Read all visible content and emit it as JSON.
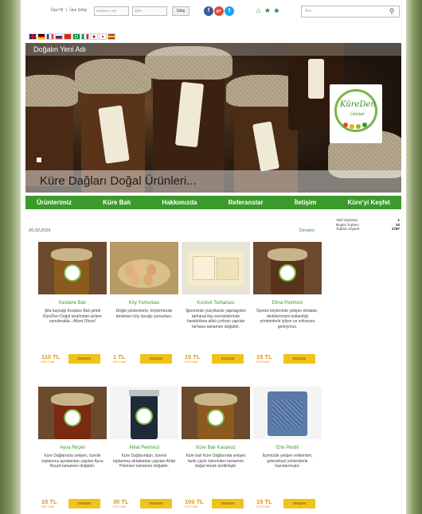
{
  "topbar": {
    "login_label": "Üye Ol",
    "separator": "|",
    "register_label": "Üye Girişi",
    "user_placeholder": "Kullanıcı Adı",
    "pass_placeholder": "Şifre",
    "login_button": "Giriş",
    "search_placeholder": "Ara...",
    "social": [
      {
        "name": "facebook",
        "glyph": "f",
        "color": "#3b5998"
      },
      {
        "name": "google-plus",
        "glyph": "g+",
        "color": "#dd4b39"
      },
      {
        "name": "twitter",
        "glyph": "t",
        "color": "#1da1f2"
      }
    ],
    "home_icons": "⌂ ★ ♣"
  },
  "flags": [
    {
      "name": "uk",
      "bg": "linear-gradient(#c8102e 0 0) center/100% 2px no-repeat, linear-gradient(#c8102e 0 0) center/2px 100% no-repeat, #012169"
    },
    {
      "name": "germany",
      "bg": "linear-gradient(#000 0 33%, #dd0000 33% 66%, #ffce00 66%)"
    },
    {
      "name": "france",
      "bg": "linear-gradient(90deg, #0055a4 0 33%, #fff 33% 66%, #ef4135 66%)"
    },
    {
      "name": "russia",
      "bg": "linear-gradient(#fff 0 33%, #0039a6 33% 66%, #d52b1e 66%)"
    },
    {
      "name": "china",
      "bg": "#de2910"
    },
    {
      "name": "brazil",
      "bg": "radial-gradient(circle, #002776 0 20%, #ffdf00 20% 45%, #009c3b 45%)"
    },
    {
      "name": "italy",
      "bg": "linear-gradient(90deg, #009246 0 33%, #fff 33% 66%, #ce2b37 66%)"
    },
    {
      "name": "japan",
      "bg": "radial-gradient(circle, #bc002d 0 30%, #fff 30%)"
    },
    {
      "name": "korea",
      "bg": "radial-gradient(circle, #cd2e3a 0 25%, #fff 25%)"
    },
    {
      "name": "spain",
      "bg": "linear-gradient(#aa151b 0 25%, #f1bf00 25% 75%, #aa151b 75%)"
    }
  ],
  "banner": {
    "top_text": "Doğalın Yeni Adı",
    "caption": "Küre Dağları Doğal Ürünleri...",
    "logo_line1": "KüreDen",
    "logo_line2": "Ürünleri"
  },
  "nav": [
    "Ürünlerimiz",
    "Küre Balı",
    "Hakkımızda",
    "Referanslar",
    "İletişim",
    "Küre'yi Keşfet"
  ],
  "info": {
    "date": "26.02.2016",
    "stats_link": "Devamı",
    "stats": [
      {
        "label": "Aktif Ziyaretçi",
        "value": "1"
      },
      {
        "label": "Bugün Toplam",
        "value": "10"
      },
      {
        "label": "Toplam Ziyaret",
        "value": "2787"
      }
    ]
  },
  "products": [
    {
      "name": "Kestane Balı",
      "desc": "Şifa kaynağı Kestane Balı şimdi KüreDen Doğal tarafından sizlere sunulmakta...Afiyet Olsun!",
      "price": "110 TL",
      "kdv": "KDV Dahil",
      "button": "Detaylar"
    },
    {
      "name": "Köy Yumurtası",
      "desc": "Doğal yöntemlerle, köylerimizde beslenen köy tavuğu yumurtası.",
      "price": "1 TL",
      "kdv": "KDV Dahil",
      "button": "Detaylar"
    },
    {
      "name": "Kızılcık Tarhanası",
      "desc": "İğzemizde yüzyıllardır yapılageleri tarhanal ikiş mevsimlerinde hastalıklara şifalı çorbası yapılan tarhana tamamen doğaldır.",
      "price": "15 TL",
      "kdv": "KDV Dahil",
      "button": "Detaylar"
    },
    {
      "name": "Elma Pekmezi",
      "desc": "İlçemiz köylerinde yetişen elmaları, dedelerimizin kullandığı yöntemlerle işliyor ve sofranıza getiriyoruz.",
      "price": "15 TL",
      "kdv": "KDV Dahil",
      "button": "Detaylar"
    },
    {
      "name": "Ayva Reçeli",
      "desc": "Küre Dağlarında yetişen, özenle toplanmış ayvalardan yapılan Ayva Reçeli tamamen doğaldır.",
      "price": "15 TL",
      "kdv": "KDV Dahil",
      "button": "Detaylar"
    },
    {
      "name": "Ahlat Pekmezi",
      "desc": "Küre Dağlarından, özenle toplanmış ahlatlardan yapılan Ahlat Pekmezi tamamen doğaldır.",
      "price": "30 TL",
      "kdv": "KDV Dahil",
      "button": "Detaylar"
    },
    {
      "name": "Küre Balı Kavanoz",
      "desc": "Küre balı Küre Dağlarında yetişen farklı çiçek özlerinden tamamen doğal olarak üretilmiştir.",
      "price": "100 TL",
      "kdv": "KDV Dahil",
      "button": "Detaylar"
    },
    {
      "name": "Erik Pestili",
      "desc": "İlçemizde yetişen eriklerden, geleneksel yöntemlerle hazırlanmıştır.",
      "price": "15 TL",
      "kdv": "KDV Dahil",
      "button": "Detaylar"
    }
  ]
}
